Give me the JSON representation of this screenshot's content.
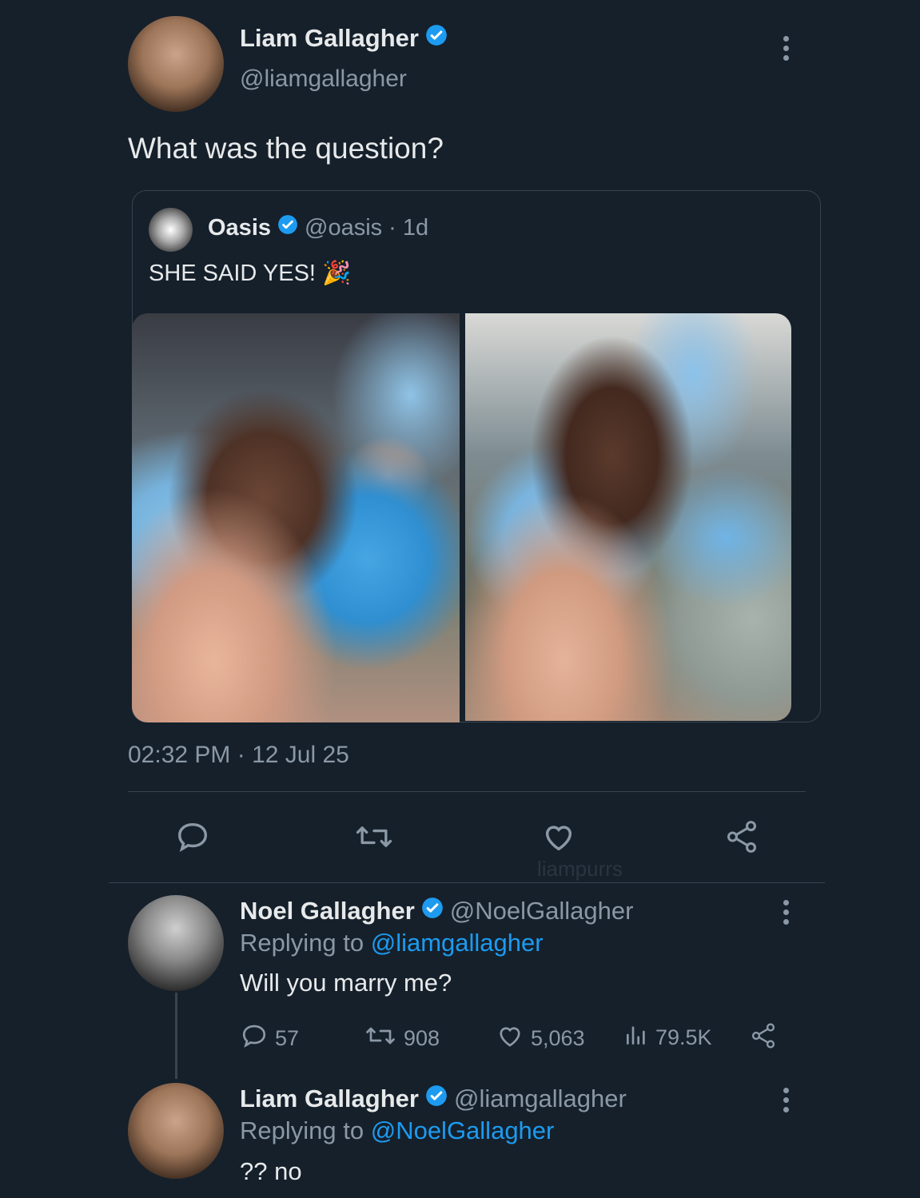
{
  "main_tweet": {
    "author_name": "Liam Gallagher",
    "author_handle": "@liamgallagher",
    "text": "What was the question?",
    "timestamp": "02:32 PM · 12 Jul 25"
  },
  "quoted_tweet": {
    "author_name": "Oasis",
    "author_handle": "@oasis",
    "time_ago": "· 1d",
    "text": "SHE SAID YES! 🎉"
  },
  "watermark": "liampurrs",
  "reply_1": {
    "author_name": "Noel Gallagher",
    "author_handle": "@NoelGallagher",
    "replying_to_label": "Replying to",
    "replying_to_handle": "@liamgallagher",
    "text": "Will you marry me?",
    "stats": {
      "replies": "57",
      "retweets": "908",
      "likes": "5,063",
      "views": "79.5K"
    }
  },
  "reply_2": {
    "author_name": "Liam Gallagher",
    "author_handle": "@liamgallagher",
    "replying_to_label": "Replying to",
    "replying_to_handle": "@NoelGallagher",
    "text": "?? no"
  },
  "colors": {
    "background": "#15202b",
    "text": "#e7e9ea",
    "muted": "#8b98a5",
    "accent": "#1d9bf0",
    "border": "#38444d"
  },
  "icons": [
    "verified-badge-icon",
    "more-icon",
    "reply-icon",
    "retweet-icon",
    "like-icon",
    "share-icon",
    "views-icon"
  ]
}
